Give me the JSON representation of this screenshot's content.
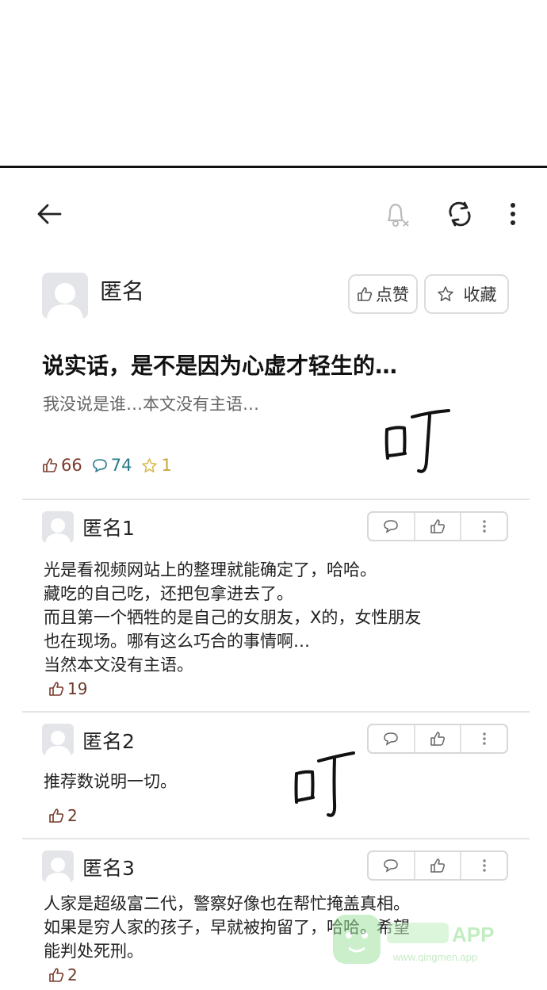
{
  "colors": {
    "like": "#7a3b2b",
    "comment": "#2a7a8a",
    "star": "#d8b84a",
    "divider": "#e4e4e4",
    "watermark": "#7fd87f"
  },
  "toolbar": {
    "back_icon": "back-arrow-icon",
    "mute_icon": "bell-muted-icon",
    "refresh_icon": "refresh-icon",
    "more_icon": "more-vertical-icon"
  },
  "post": {
    "author": "匿名",
    "like_button": "点赞",
    "favorite_button": "收藏",
    "title": "说实话，是不是因为心虚才轻生的…",
    "subtitle": "我没说是谁…本文没有主语…",
    "stats": {
      "likes": "66",
      "comments": "74",
      "favorites": "1"
    }
  },
  "sfx": "叮",
  "comments": [
    {
      "author": "匿名1",
      "lines": [
        "光是看视频网站上的整理就能确定了，哈哈。",
        "藏吃的自己吃，还把包拿进去了。",
        "而且第一个牺牲的是自己的女朋友，X的，女性朋友",
        "也在现场。哪有这么巧合的事情啊…",
        "当然本文没有主语。"
      ],
      "likes": "19"
    },
    {
      "author": "匿名2",
      "lines": [
        "推荐数说明一切。"
      ],
      "likes": "2"
    },
    {
      "author": "匿名3",
      "lines": [
        "人家是超级富二代，警察好像也在帮忙掩盖真相。",
        "如果是穷人家的孩子，早就被拘留了，哈哈。希望",
        "能判处死刑。"
      ],
      "likes": "2"
    }
  ],
  "watermark": {
    "brand": "APP",
    "url": "www.qingmen.app"
  }
}
